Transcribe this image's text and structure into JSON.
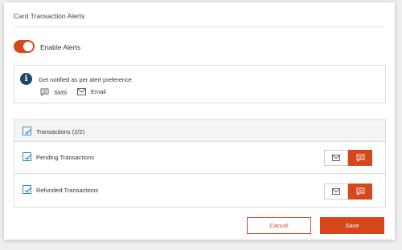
{
  "card": {
    "title": "Card Transaction Alerts"
  },
  "toggle": {
    "label": "Enable Alerts",
    "state": "on"
  },
  "info": {
    "icon": "info-icon",
    "text": "Get notified as per alert preference",
    "channels": [
      {
        "icon": "sms-icon",
        "label": "SMS"
      },
      {
        "icon": "email-icon",
        "label": "Email"
      }
    ]
  },
  "transactions": {
    "header_label": "Transactions (2/2)",
    "header_checked": true,
    "rows": [
      {
        "label": "Pending Transactions",
        "checked": true,
        "email_selected": false,
        "sms_selected": true
      },
      {
        "label": "Refunded Transactions",
        "checked": true,
        "email_selected": false,
        "sms_selected": true
      }
    ]
  },
  "actions": {
    "cancel_label": "Cancel",
    "save_label": "Save"
  },
  "colors": {
    "accent": "#d6471c",
    "info_icon": "#1c4a66",
    "checkbox_border": "#2a8bb5"
  }
}
